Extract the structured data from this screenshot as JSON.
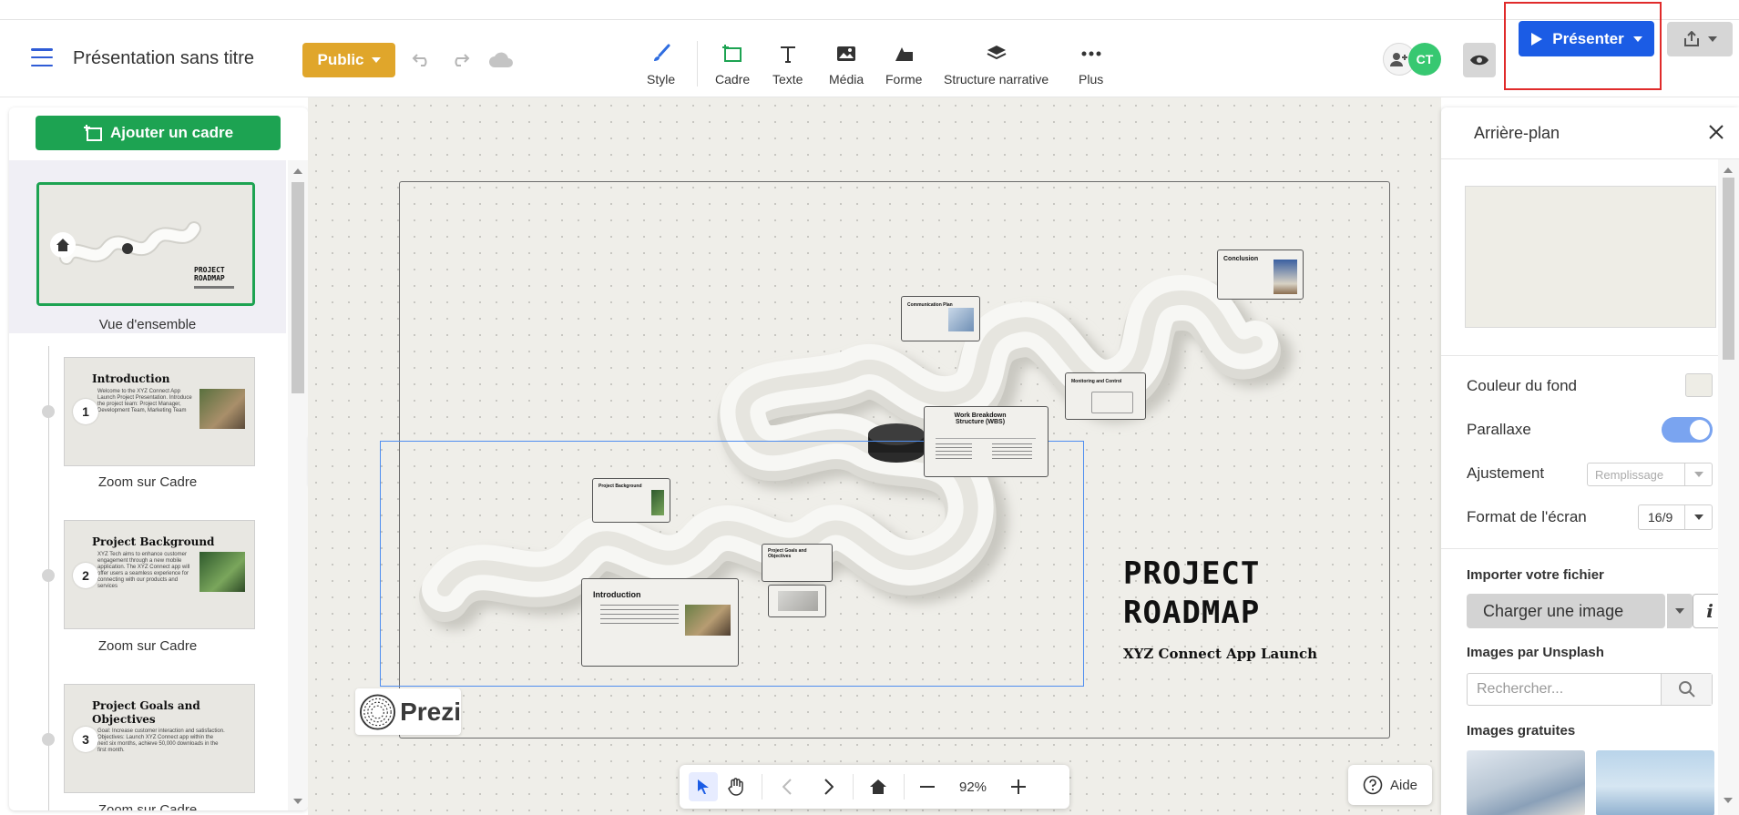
{
  "header": {
    "doc_title": "Présentation sans titre",
    "visibility_label": "Public",
    "present_label": "Présenter",
    "avatar_initials": "CT",
    "tools": [
      {
        "label": "Style",
        "icon": "brush-icon"
      },
      {
        "label": "Cadre",
        "icon": "frame-icon"
      },
      {
        "label": "Texte",
        "icon": "text-icon"
      },
      {
        "label": "Média",
        "icon": "image-icon"
      },
      {
        "label": "Forme",
        "icon": "shape-icon"
      },
      {
        "label": "Structure narrative",
        "icon": "layers-icon"
      },
      {
        "label": "Plus",
        "icon": "more-icon"
      }
    ]
  },
  "left_panel": {
    "add_frame_label": "Ajouter un cadre",
    "overview_label": "Vue d'ensemble",
    "overview_title": "PROJECT ROADMAP",
    "frames": [
      {
        "number": "1",
        "title": "Introduction",
        "label": "Zoom sur Cadre",
        "text": "Welcome to the XYZ Connect App Launch Project Presentation. Introduce the project team: Project Manager, Development Team, Marketing Team"
      },
      {
        "number": "2",
        "title": "Project Background",
        "label": "Zoom sur Cadre",
        "text": "XYZ Tech aims to enhance customer engagement through a new mobile application. The XYZ Connect app will offer users a seamless experience for connecting with our products and services"
      },
      {
        "number": "3",
        "title": "Project Goals and Objectives",
        "label": "Zoom sur Cadre",
        "text": "Goal: Increase customer interaction and satisfaction. Objectives: Launch XYZ Connect app within the next six months, achieve 50,000 downloads in the first month."
      }
    ]
  },
  "canvas": {
    "title_line1": "PROJECT",
    "title_line2": "ROADMAP",
    "subtitle": "XYZ Connect App Launch",
    "brand": "Prezi",
    "cards": {
      "conclusion": "Conclusion",
      "communication": "Communication Plan",
      "monitoring": "Monitoring and Control",
      "wbs": "Work Breakdown Structure (WBS)",
      "background": "Project Background",
      "goals": "Project Goals and Objectives",
      "introduction": "Introduction"
    }
  },
  "bottom_bar": {
    "zoom": "92%",
    "help_label": "Aide"
  },
  "right_panel": {
    "title": "Arrière-plan",
    "bg_color_label": "Couleur du fond",
    "parallax_label": "Parallaxe",
    "fit_label": "Ajustement",
    "fit_value": "Remplissage",
    "screen_format_label": "Format de l'écran",
    "screen_format_value": "16/9",
    "import_label": "Importer votre fichier",
    "upload_label": "Charger une image",
    "unsplash_label": "Images par Unsplash",
    "search_placeholder": "Rechercher...",
    "free_images_label": "Images gratuites"
  },
  "colors": {
    "accent_blue": "#1b5ce5",
    "green": "#1da352",
    "public_yellow": "#e0a62b",
    "canvas_bg": "#efeee9"
  }
}
